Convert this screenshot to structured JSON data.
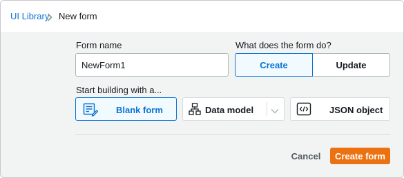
{
  "breadcrumb": {
    "parent": "UI Library",
    "current": "New form"
  },
  "form": {
    "name_label": "Form name",
    "name_value": "NewForm1",
    "purpose_label": "What does the form do?",
    "purpose_options": [
      "Create",
      "Update"
    ],
    "purpose_selected": "Create",
    "start_label": "Start building with a...",
    "start_options": [
      {
        "label": "Blank form",
        "icon": "blank-form-icon",
        "selected": true
      },
      {
        "label": "Data model",
        "icon": "data-model-icon",
        "selected": false
      },
      {
        "label": "JSON object",
        "icon": "json-object-icon",
        "selected": false
      }
    ]
  },
  "actions": {
    "cancel": "Cancel",
    "submit": "Create form"
  },
  "colors": {
    "accent": "#0972d3",
    "primary_button": "#ec7211",
    "selected_bg": "#f1faff"
  }
}
